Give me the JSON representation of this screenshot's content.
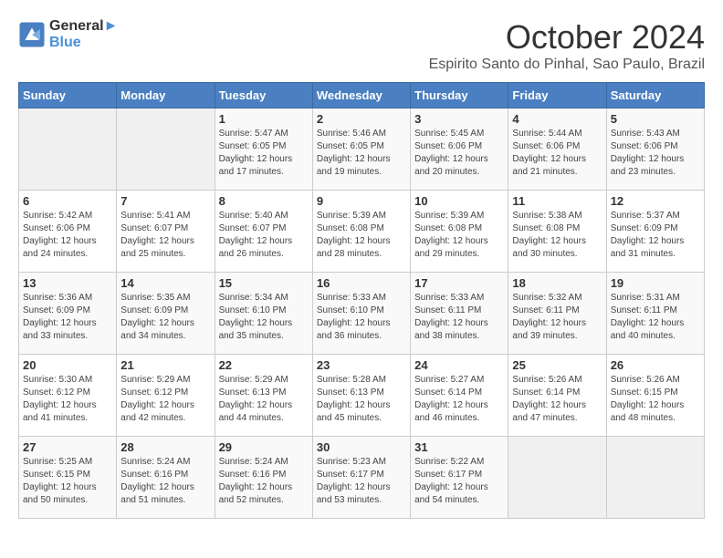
{
  "header": {
    "logo_line1": "General",
    "logo_line2": "Blue",
    "month_title": "October 2024",
    "location": "Espirito Santo do Pinhal, Sao Paulo, Brazil"
  },
  "weekdays": [
    "Sunday",
    "Monday",
    "Tuesday",
    "Wednesday",
    "Thursday",
    "Friday",
    "Saturday"
  ],
  "weeks": [
    [
      {
        "day": "",
        "info": ""
      },
      {
        "day": "",
        "info": ""
      },
      {
        "day": "1",
        "info": "Sunrise: 5:47 AM\nSunset: 6:05 PM\nDaylight: 12 hours\nand 17 minutes."
      },
      {
        "day": "2",
        "info": "Sunrise: 5:46 AM\nSunset: 6:05 PM\nDaylight: 12 hours\nand 19 minutes."
      },
      {
        "day": "3",
        "info": "Sunrise: 5:45 AM\nSunset: 6:06 PM\nDaylight: 12 hours\nand 20 minutes."
      },
      {
        "day": "4",
        "info": "Sunrise: 5:44 AM\nSunset: 6:06 PM\nDaylight: 12 hours\nand 21 minutes."
      },
      {
        "day": "5",
        "info": "Sunrise: 5:43 AM\nSunset: 6:06 PM\nDaylight: 12 hours\nand 23 minutes."
      }
    ],
    [
      {
        "day": "6",
        "info": "Sunrise: 5:42 AM\nSunset: 6:06 PM\nDaylight: 12 hours\nand 24 minutes."
      },
      {
        "day": "7",
        "info": "Sunrise: 5:41 AM\nSunset: 6:07 PM\nDaylight: 12 hours\nand 25 minutes."
      },
      {
        "day": "8",
        "info": "Sunrise: 5:40 AM\nSunset: 6:07 PM\nDaylight: 12 hours\nand 26 minutes."
      },
      {
        "day": "9",
        "info": "Sunrise: 5:39 AM\nSunset: 6:08 PM\nDaylight: 12 hours\nand 28 minutes."
      },
      {
        "day": "10",
        "info": "Sunrise: 5:39 AM\nSunset: 6:08 PM\nDaylight: 12 hours\nand 29 minutes."
      },
      {
        "day": "11",
        "info": "Sunrise: 5:38 AM\nSunset: 6:08 PM\nDaylight: 12 hours\nand 30 minutes."
      },
      {
        "day": "12",
        "info": "Sunrise: 5:37 AM\nSunset: 6:09 PM\nDaylight: 12 hours\nand 31 minutes."
      }
    ],
    [
      {
        "day": "13",
        "info": "Sunrise: 5:36 AM\nSunset: 6:09 PM\nDaylight: 12 hours\nand 33 minutes."
      },
      {
        "day": "14",
        "info": "Sunrise: 5:35 AM\nSunset: 6:09 PM\nDaylight: 12 hours\nand 34 minutes."
      },
      {
        "day": "15",
        "info": "Sunrise: 5:34 AM\nSunset: 6:10 PM\nDaylight: 12 hours\nand 35 minutes."
      },
      {
        "day": "16",
        "info": "Sunrise: 5:33 AM\nSunset: 6:10 PM\nDaylight: 12 hours\nand 36 minutes."
      },
      {
        "day": "17",
        "info": "Sunrise: 5:33 AM\nSunset: 6:11 PM\nDaylight: 12 hours\nand 38 minutes."
      },
      {
        "day": "18",
        "info": "Sunrise: 5:32 AM\nSunset: 6:11 PM\nDaylight: 12 hours\nand 39 minutes."
      },
      {
        "day": "19",
        "info": "Sunrise: 5:31 AM\nSunset: 6:11 PM\nDaylight: 12 hours\nand 40 minutes."
      }
    ],
    [
      {
        "day": "20",
        "info": "Sunrise: 5:30 AM\nSunset: 6:12 PM\nDaylight: 12 hours\nand 41 minutes."
      },
      {
        "day": "21",
        "info": "Sunrise: 5:29 AM\nSunset: 6:12 PM\nDaylight: 12 hours\nand 42 minutes."
      },
      {
        "day": "22",
        "info": "Sunrise: 5:29 AM\nSunset: 6:13 PM\nDaylight: 12 hours\nand 44 minutes."
      },
      {
        "day": "23",
        "info": "Sunrise: 5:28 AM\nSunset: 6:13 PM\nDaylight: 12 hours\nand 45 minutes."
      },
      {
        "day": "24",
        "info": "Sunrise: 5:27 AM\nSunset: 6:14 PM\nDaylight: 12 hours\nand 46 minutes."
      },
      {
        "day": "25",
        "info": "Sunrise: 5:26 AM\nSunset: 6:14 PM\nDaylight: 12 hours\nand 47 minutes."
      },
      {
        "day": "26",
        "info": "Sunrise: 5:26 AM\nSunset: 6:15 PM\nDaylight: 12 hours\nand 48 minutes."
      }
    ],
    [
      {
        "day": "27",
        "info": "Sunrise: 5:25 AM\nSunset: 6:15 PM\nDaylight: 12 hours\nand 50 minutes."
      },
      {
        "day": "28",
        "info": "Sunrise: 5:24 AM\nSunset: 6:16 PM\nDaylight: 12 hours\nand 51 minutes."
      },
      {
        "day": "29",
        "info": "Sunrise: 5:24 AM\nSunset: 6:16 PM\nDaylight: 12 hours\nand 52 minutes."
      },
      {
        "day": "30",
        "info": "Sunrise: 5:23 AM\nSunset: 6:17 PM\nDaylight: 12 hours\nand 53 minutes."
      },
      {
        "day": "31",
        "info": "Sunrise: 5:22 AM\nSunset: 6:17 PM\nDaylight: 12 hours\nand 54 minutes."
      },
      {
        "day": "",
        "info": ""
      },
      {
        "day": "",
        "info": ""
      }
    ]
  ]
}
